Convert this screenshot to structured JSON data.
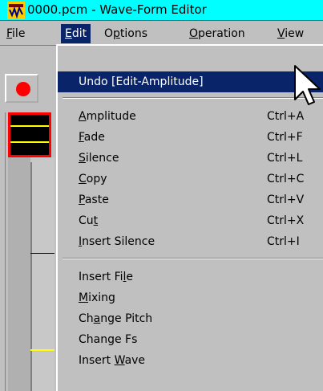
{
  "window": {
    "title": "0000.pcm - Wave-Form Editor",
    "title_color": "#00ffff",
    "app_icon": "wave-editor-app-icon"
  },
  "menubar": {
    "items": [
      {
        "label": "File",
        "mnemonic": "F"
      },
      {
        "label": "Edit",
        "mnemonic": "E"
      },
      {
        "label": "Options",
        "mnemonic": "p"
      },
      {
        "label": "Operation",
        "mnemonic": "O"
      },
      {
        "label": "View",
        "mnemonic": "V"
      }
    ],
    "active": "Edit",
    "highlight_color": "#0a246a"
  },
  "toolbar": {
    "record_icon": "record-icon",
    "record_color": "#ff0000"
  },
  "edit_menu": {
    "undo_label": "Undo [Edit-Amplitude]",
    "items_group1": [
      {
        "label": "Amplitude",
        "shortcut": "Ctrl+A"
      },
      {
        "label": "Fade",
        "shortcut": "Ctrl+F"
      },
      {
        "label": "Silence",
        "shortcut": "Ctrl+L"
      },
      {
        "label": "Copy",
        "shortcut": "Ctrl+C"
      },
      {
        "label": "Paste",
        "shortcut": "Ctrl+V"
      },
      {
        "label": "Cut",
        "shortcut": "Ctrl+X"
      },
      {
        "label": "Insert Silence",
        "shortcut": "Ctrl+I"
      }
    ],
    "items_group2": [
      {
        "label": "Insert File"
      },
      {
        "label": "Mixing"
      },
      {
        "label": "Change Pitch"
      },
      {
        "label": "Change Fs"
      },
      {
        "label": "Insert Wave"
      }
    ]
  }
}
